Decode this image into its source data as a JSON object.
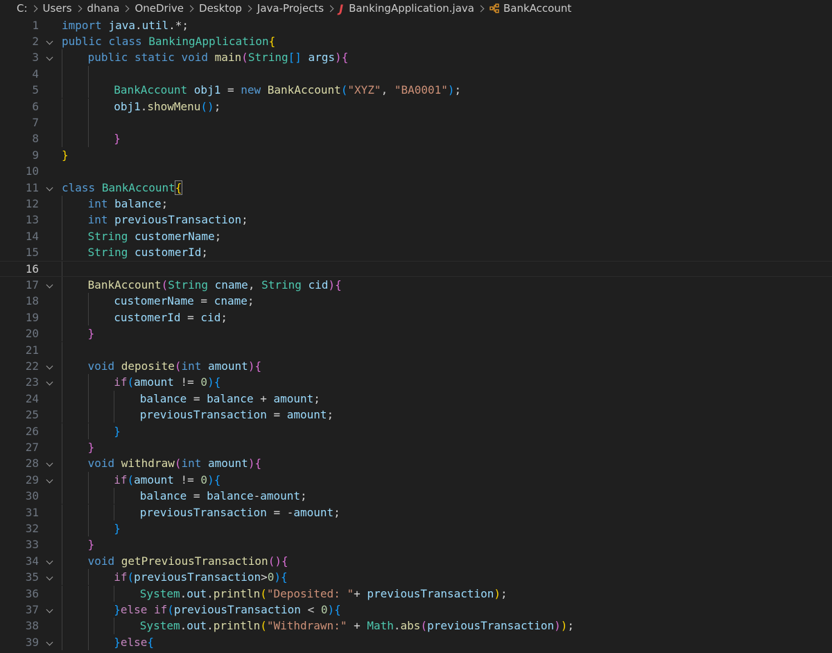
{
  "breadcrumb": {
    "drive": "C:",
    "segments": [
      "Users",
      "dhana",
      "OneDrive",
      "Desktop",
      "Java-Projects"
    ],
    "file_icon": "java-file-icon",
    "file": "BankingApplication.java",
    "symbol_icon": "class-symbol-icon",
    "symbol": "BankAccount"
  },
  "editor": {
    "current_line": 16,
    "colors": {
      "background": "#1f1f1f",
      "keyword": "#569cd6",
      "control": "#c586c0",
      "type": "#4ec9b0",
      "function": "#dcdcaa",
      "variable": "#9cdcfe",
      "string": "#ce9178",
      "number": "#b5cea8"
    },
    "lines": [
      {
        "n": "1",
        "fold": false,
        "indent": 0,
        "tokens": [
          [
            "kw",
            "import"
          ],
          [
            "p",
            " "
          ],
          [
            "var",
            "java"
          ],
          [
            "p",
            "."
          ],
          [
            "var",
            "util"
          ],
          [
            "p",
            ".*;"
          ]
        ]
      },
      {
        "n": "2",
        "fold": true,
        "indent": 0,
        "tokens": [
          [
            "kw",
            "public"
          ],
          [
            "p",
            " "
          ],
          [
            "kw",
            "class"
          ],
          [
            "p",
            " "
          ],
          [
            "type",
            "BankingApplication"
          ],
          [
            "b1",
            "{"
          ]
        ]
      },
      {
        "n": "3",
        "fold": true,
        "indent": 1,
        "tokens": [
          [
            "kw",
            "public"
          ],
          [
            "p",
            " "
          ],
          [
            "kw",
            "static"
          ],
          [
            "p",
            " "
          ],
          [
            "kw",
            "void"
          ],
          [
            "p",
            " "
          ],
          [
            "fn",
            "main"
          ],
          [
            "b2",
            "("
          ],
          [
            "type",
            "String"
          ],
          [
            "b3",
            "[]"
          ],
          [
            "p",
            " "
          ],
          [
            "var",
            "args"
          ],
          [
            "b2",
            ")"
          ],
          [
            "b2",
            "{"
          ]
        ]
      },
      {
        "n": "4",
        "fold": false,
        "indent": 2,
        "tokens": []
      },
      {
        "n": "5",
        "fold": false,
        "indent": 2,
        "tokens": [
          [
            "type",
            "BankAccount"
          ],
          [
            "p",
            " "
          ],
          [
            "var",
            "obj1"
          ],
          [
            "p",
            " = "
          ],
          [
            "kw",
            "new"
          ],
          [
            "p",
            " "
          ],
          [
            "fn",
            "BankAccount"
          ],
          [
            "b3",
            "("
          ],
          [
            "str",
            "\"XYZ\""
          ],
          [
            "p",
            ", "
          ],
          [
            "str",
            "\"BA0001\""
          ],
          [
            "b3",
            ")"
          ],
          [
            "p",
            ";"
          ]
        ]
      },
      {
        "n": "6",
        "fold": false,
        "indent": 2,
        "tokens": [
          [
            "var",
            "obj1"
          ],
          [
            "p",
            "."
          ],
          [
            "fn",
            "showMenu"
          ],
          [
            "b3",
            "()"
          ],
          [
            "p",
            ";"
          ]
        ]
      },
      {
        "n": "7",
        "fold": false,
        "indent": 2,
        "tokens": []
      },
      {
        "n": "8",
        "fold": false,
        "indent": 2,
        "tokens": [
          [
            "b2",
            "}"
          ]
        ]
      },
      {
        "n": "9",
        "fold": false,
        "indent": 0,
        "tokens": [
          [
            "b1",
            "}"
          ]
        ]
      },
      {
        "n": "10",
        "fold": false,
        "indent": 0,
        "tokens": []
      },
      {
        "n": "11",
        "fold": true,
        "indent": 0,
        "tokens": [
          [
            "kw",
            "class"
          ],
          [
            "p",
            " "
          ],
          [
            "type",
            "BankAccount"
          ],
          [
            "bm",
            "{"
          ]
        ]
      },
      {
        "n": "12",
        "fold": false,
        "indent": 1,
        "tokens": [
          [
            "kw",
            "int"
          ],
          [
            "p",
            " "
          ],
          [
            "var",
            "balance"
          ],
          [
            "p",
            ";"
          ]
        ]
      },
      {
        "n": "13",
        "fold": false,
        "indent": 1,
        "tokens": [
          [
            "kw",
            "int"
          ],
          [
            "p",
            " "
          ],
          [
            "var",
            "previousTransaction"
          ],
          [
            "p",
            ";"
          ]
        ]
      },
      {
        "n": "14",
        "fold": false,
        "indent": 1,
        "tokens": [
          [
            "type",
            "String"
          ],
          [
            "p",
            " "
          ],
          [
            "var",
            "customerName"
          ],
          [
            "p",
            ";"
          ]
        ]
      },
      {
        "n": "15",
        "fold": false,
        "indent": 1,
        "tokens": [
          [
            "type",
            "String"
          ],
          [
            "p",
            " "
          ],
          [
            "var",
            "customerId"
          ],
          [
            "p",
            ";"
          ]
        ]
      },
      {
        "n": "16",
        "fold": false,
        "indent": 1,
        "tokens": []
      },
      {
        "n": "17",
        "fold": true,
        "indent": 1,
        "tokens": [
          [
            "fn",
            "BankAccount"
          ],
          [
            "b2",
            "("
          ],
          [
            "type",
            "String"
          ],
          [
            "p",
            " "
          ],
          [
            "var",
            "cname"
          ],
          [
            "p",
            ", "
          ],
          [
            "type",
            "String"
          ],
          [
            "p",
            " "
          ],
          [
            "var",
            "cid"
          ],
          [
            "b2",
            ")"
          ],
          [
            "b2",
            "{"
          ]
        ]
      },
      {
        "n": "18",
        "fold": false,
        "indent": 2,
        "tokens": [
          [
            "var",
            "customerName"
          ],
          [
            "p",
            " = "
          ],
          [
            "var",
            "cname"
          ],
          [
            "p",
            ";"
          ]
        ]
      },
      {
        "n": "19",
        "fold": false,
        "indent": 2,
        "tokens": [
          [
            "var",
            "customerId"
          ],
          [
            "p",
            " = "
          ],
          [
            "var",
            "cid"
          ],
          [
            "p",
            ";"
          ]
        ]
      },
      {
        "n": "20",
        "fold": false,
        "indent": 1,
        "tokens": [
          [
            "b2",
            "}"
          ]
        ]
      },
      {
        "n": "21",
        "fold": false,
        "indent": 1,
        "tokens": []
      },
      {
        "n": "22",
        "fold": true,
        "indent": 1,
        "tokens": [
          [
            "kw",
            "void"
          ],
          [
            "p",
            " "
          ],
          [
            "fn",
            "deposite"
          ],
          [
            "b2",
            "("
          ],
          [
            "kw",
            "int"
          ],
          [
            "p",
            " "
          ],
          [
            "var",
            "amount"
          ],
          [
            "b2",
            ")"
          ],
          [
            "b2",
            "{"
          ]
        ]
      },
      {
        "n": "23",
        "fold": true,
        "indent": 2,
        "tokens": [
          [
            "ctl",
            "if"
          ],
          [
            "b3",
            "("
          ],
          [
            "var",
            "amount"
          ],
          [
            "p",
            " != "
          ],
          [
            "num",
            "0"
          ],
          [
            "b3",
            ")"
          ],
          [
            "b3",
            "{"
          ]
        ]
      },
      {
        "n": "24",
        "fold": false,
        "indent": 3,
        "tokens": [
          [
            "var",
            "balance"
          ],
          [
            "p",
            " = "
          ],
          [
            "var",
            "balance"
          ],
          [
            "p",
            " + "
          ],
          [
            "var",
            "amount"
          ],
          [
            "p",
            ";"
          ]
        ]
      },
      {
        "n": "25",
        "fold": false,
        "indent": 3,
        "tokens": [
          [
            "var",
            "previousTransaction"
          ],
          [
            "p",
            " = "
          ],
          [
            "var",
            "amount"
          ],
          [
            "p",
            ";"
          ]
        ]
      },
      {
        "n": "26",
        "fold": false,
        "indent": 2,
        "tokens": [
          [
            "b3",
            "}"
          ]
        ]
      },
      {
        "n": "27",
        "fold": false,
        "indent": 1,
        "tokens": [
          [
            "b2",
            "}"
          ]
        ]
      },
      {
        "n": "28",
        "fold": true,
        "indent": 1,
        "tokens": [
          [
            "kw",
            "void"
          ],
          [
            "p",
            " "
          ],
          [
            "fn",
            "withdraw"
          ],
          [
            "b2",
            "("
          ],
          [
            "kw",
            "int"
          ],
          [
            "p",
            " "
          ],
          [
            "var",
            "amount"
          ],
          [
            "b2",
            ")"
          ],
          [
            "b2",
            "{"
          ]
        ]
      },
      {
        "n": "29",
        "fold": true,
        "indent": 2,
        "tokens": [
          [
            "ctl",
            "if"
          ],
          [
            "b3",
            "("
          ],
          [
            "var",
            "amount"
          ],
          [
            "p",
            " != "
          ],
          [
            "num",
            "0"
          ],
          [
            "b3",
            ")"
          ],
          [
            "b3",
            "{"
          ]
        ]
      },
      {
        "n": "30",
        "fold": false,
        "indent": 3,
        "tokens": [
          [
            "var",
            "balance"
          ],
          [
            "p",
            " = "
          ],
          [
            "var",
            "balance"
          ],
          [
            "p",
            "-"
          ],
          [
            "var",
            "amount"
          ],
          [
            "p",
            ";"
          ]
        ]
      },
      {
        "n": "31",
        "fold": false,
        "indent": 3,
        "tokens": [
          [
            "var",
            "previousTransaction"
          ],
          [
            "p",
            " = -"
          ],
          [
            "var",
            "amount"
          ],
          [
            "p",
            ";"
          ]
        ]
      },
      {
        "n": "32",
        "fold": false,
        "indent": 2,
        "tokens": [
          [
            "b3",
            "}"
          ]
        ]
      },
      {
        "n": "33",
        "fold": false,
        "indent": 1,
        "tokens": [
          [
            "b2",
            "}"
          ]
        ]
      },
      {
        "n": "34",
        "fold": true,
        "indent": 1,
        "tokens": [
          [
            "kw",
            "void"
          ],
          [
            "p",
            " "
          ],
          [
            "fn",
            "getPreviousTransaction"
          ],
          [
            "b2",
            "()"
          ],
          [
            "b2",
            "{"
          ]
        ]
      },
      {
        "n": "35",
        "fold": true,
        "indent": 2,
        "tokens": [
          [
            "ctl",
            "if"
          ],
          [
            "b3",
            "("
          ],
          [
            "var",
            "previousTransaction"
          ],
          [
            "p",
            ">"
          ],
          [
            "num",
            "0"
          ],
          [
            "b3",
            ")"
          ],
          [
            "b3",
            "{"
          ]
        ]
      },
      {
        "n": "36",
        "fold": false,
        "indent": 3,
        "tokens": [
          [
            "type",
            "System"
          ],
          [
            "p",
            "."
          ],
          [
            "var",
            "out"
          ],
          [
            "p",
            "."
          ],
          [
            "fn",
            "println"
          ],
          [
            "b1",
            "("
          ],
          [
            "str",
            "\"Deposited: \""
          ],
          [
            "p",
            "+ "
          ],
          [
            "var",
            "previousTransaction"
          ],
          [
            "b1",
            ")"
          ],
          [
            "p",
            ";"
          ]
        ]
      },
      {
        "n": "37",
        "fold": true,
        "indent": 2,
        "tokens": [
          [
            "b3",
            "}"
          ],
          [
            "ctl",
            "else"
          ],
          [
            "p",
            " "
          ],
          [
            "ctl",
            "if"
          ],
          [
            "b3",
            "("
          ],
          [
            "var",
            "previousTransaction"
          ],
          [
            "p",
            " < "
          ],
          [
            "num",
            "0"
          ],
          [
            "b3",
            ")"
          ],
          [
            "b3",
            "{"
          ]
        ]
      },
      {
        "n": "38",
        "fold": false,
        "indent": 3,
        "tokens": [
          [
            "type",
            "System"
          ],
          [
            "p",
            "."
          ],
          [
            "var",
            "out"
          ],
          [
            "p",
            "."
          ],
          [
            "fn",
            "println"
          ],
          [
            "b1",
            "("
          ],
          [
            "str",
            "\"Withdrawn:\""
          ],
          [
            "p",
            " + "
          ],
          [
            "type",
            "Math"
          ],
          [
            "p",
            "."
          ],
          [
            "fn",
            "abs"
          ],
          [
            "b2",
            "("
          ],
          [
            "var",
            "previousTransaction"
          ],
          [
            "b2",
            ")"
          ],
          [
            "b1",
            ")"
          ],
          [
            "p",
            ";"
          ]
        ]
      },
      {
        "n": "39",
        "fold": true,
        "indent": 2,
        "tokens": [
          [
            "b3",
            "}"
          ],
          [
            "ctl",
            "else"
          ],
          [
            "b3",
            "{"
          ]
        ]
      }
    ]
  }
}
